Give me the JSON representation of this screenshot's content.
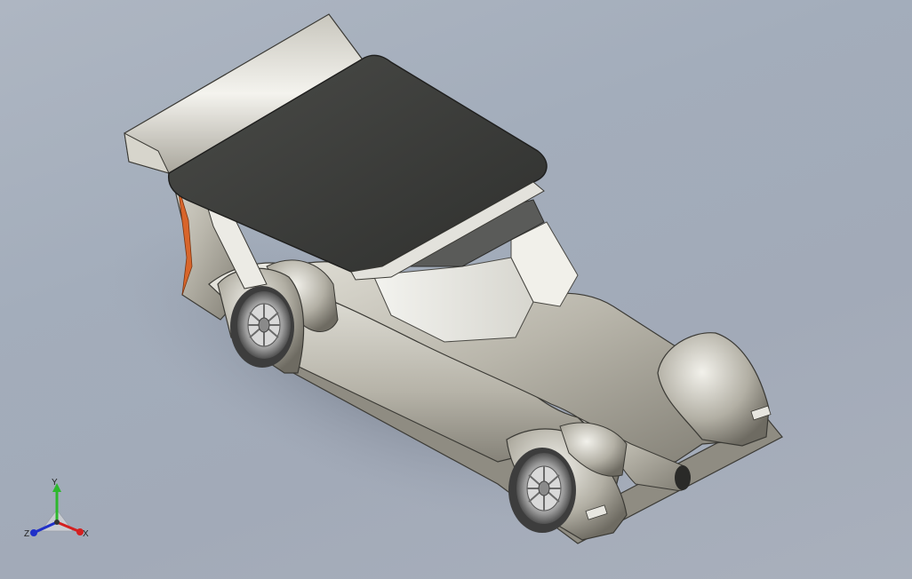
{
  "viewport": {
    "background_top": "#aeb6c2",
    "background_bottom": "#a9b0bc",
    "model_body_color": "#c9c7bd",
    "wing_panel_color": "#3b3c3a",
    "accent_color": "#d8652b"
  },
  "triad": {
    "y_label": "Y",
    "x_label": "X",
    "z_label": "Z",
    "y_color": "#2db82d",
    "x_color": "#d42020",
    "z_color": "#2030c8"
  }
}
